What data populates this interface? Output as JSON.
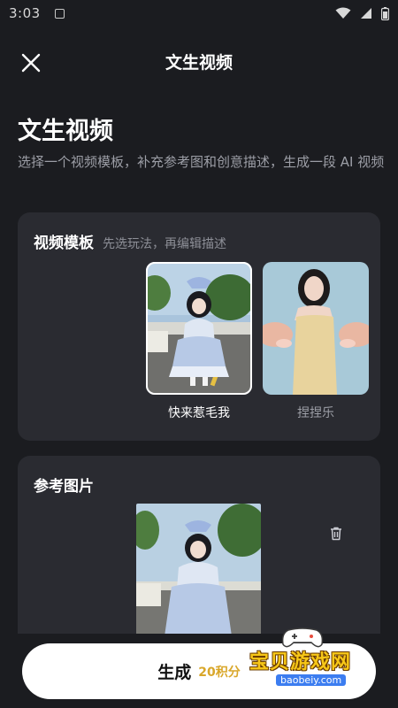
{
  "status_bar": {
    "time": "3:03"
  },
  "header": {
    "title": "文生视频",
    "close_icon": "close-icon"
  },
  "page": {
    "title": "文生视频",
    "description": "选择一个视频模板，补充参考图和创意描述，生成一段 AI 视频"
  },
  "template_card": {
    "title": "视频模板",
    "subtitle": "先选玩法，再编辑描述",
    "items": [
      {
        "label": "快来惹毛我",
        "selected": true
      },
      {
        "label": "捏捏乐",
        "selected": false
      }
    ]
  },
  "reference_card": {
    "title": "参考图片",
    "delete_icon": "trash-icon"
  },
  "generate": {
    "label": "生成",
    "cost": "20积分"
  },
  "watermark": {
    "text": "宝贝游戏网",
    "url": "baobeiy.com"
  },
  "colors": {
    "background": "#1b1c20",
    "card": "#2a2b31",
    "accent_cost": "#d9a72a",
    "button": "#ffffff"
  }
}
